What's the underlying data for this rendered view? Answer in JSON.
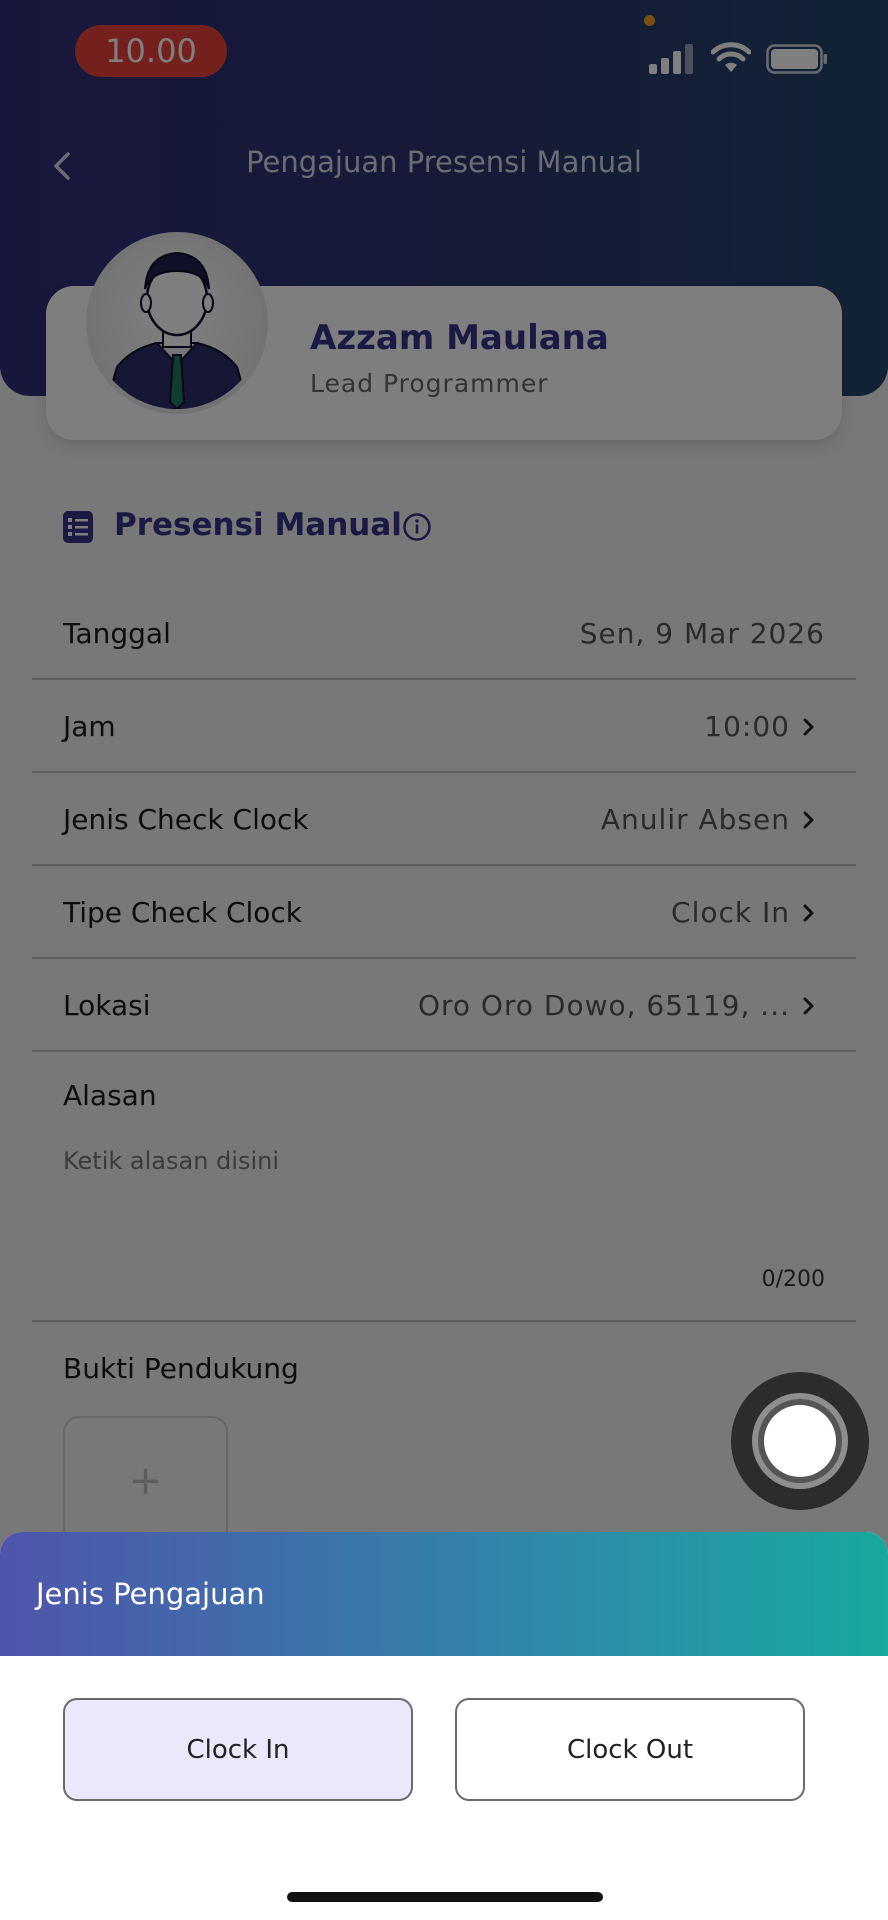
{
  "status_bar": {
    "time": "10.00"
  },
  "header": {
    "title": "Pengajuan Presensi Manual"
  },
  "profile": {
    "name": "Azzam Maulana",
    "role": "Lead Programmer"
  },
  "section": {
    "title": "Presensi Manual"
  },
  "form": {
    "rows": [
      {
        "label": "Tanggal",
        "value": "Sen, 9 Mar 2026"
      },
      {
        "label": "Jam",
        "value": "10:00"
      },
      {
        "label": "Jenis Check Clock",
        "value": "Anulir Absen"
      },
      {
        "label": "Tipe Check Clock",
        "value": "Clock In"
      },
      {
        "label": "Lokasi",
        "value": "Oro Oro Dowo, 65119, ..."
      }
    ],
    "alasan": {
      "label": "Alasan",
      "placeholder": "Ketik alasan disini",
      "counter": "0/200"
    },
    "bukti": {
      "label": "Bukti Pendukung",
      "add_symbol": "+"
    }
  },
  "sheet": {
    "title": "Jenis Pengajuan",
    "options": [
      {
        "label": "Clock In",
        "selected": true
      },
      {
        "label": "Clock Out",
        "selected": false
      }
    ]
  },
  "colors": {
    "header_gradient_start": "#2f2f7a",
    "header_gradient_end": "#24466a",
    "accent": "#35358a",
    "time_pill": "#e8413b",
    "sheet_gradient_start": "#4f55ab",
    "sheet_gradient_end": "#18a99f",
    "selected_option_bg": "#e9e9fb"
  },
  "icons": {
    "back": "chevron-left-icon",
    "section": "checklist-icon",
    "info": "info-circle-icon",
    "chevron": "chevron-right-icon",
    "add": "plus-icon"
  }
}
